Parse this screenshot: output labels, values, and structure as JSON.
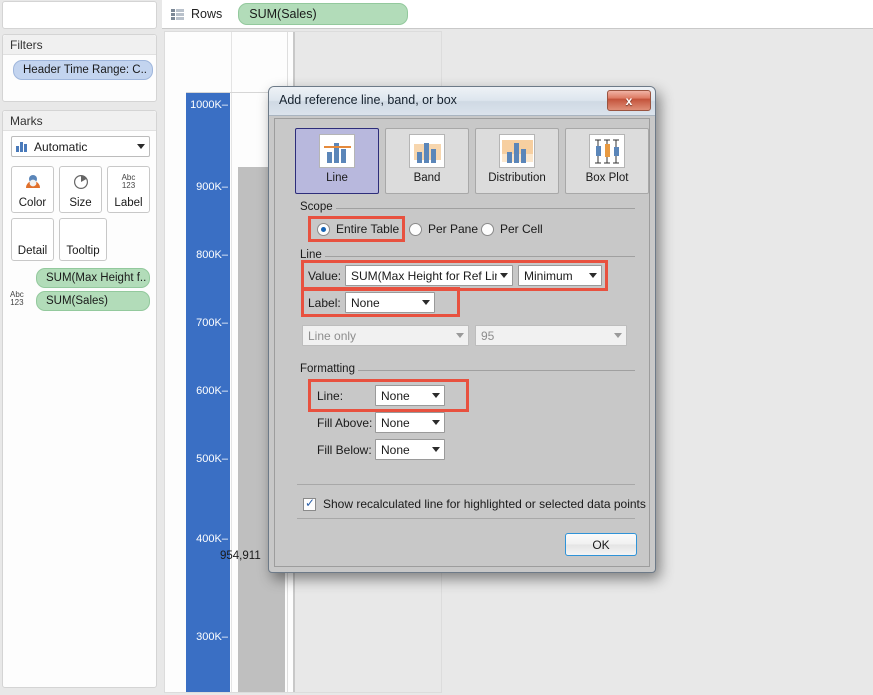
{
  "left_panel": {
    "filters": {
      "title": "Filters",
      "pills": [
        {
          "label": "Header Time Range: C..",
          "icon": "filter-pill"
        }
      ]
    },
    "marks": {
      "title": "Marks",
      "mark_type": "Automatic",
      "mark_type_icon": "bar-chart-icon",
      "buttons": [
        {
          "label": "Color",
          "icon": "color-palette-icon"
        },
        {
          "label": "Size",
          "icon": "size-pie-icon"
        },
        {
          "label": "Label",
          "icon": "abc123-icon"
        },
        {
          "label": "Detail",
          "icon": "detail-icon"
        },
        {
          "label": "Tooltip",
          "icon": "tooltip-icon"
        }
      ],
      "pills": [
        {
          "label": "SUM(Max Height f..",
          "icon": ""
        },
        {
          "label": "SUM(Sales)",
          "icon": "abc123-icon"
        }
      ]
    }
  },
  "rows_shelf": {
    "icon": "rows-grid-icon",
    "label": "Rows",
    "pill": "SUM(Sales)"
  },
  "chart_data": {
    "type": "bar",
    "title": "",
    "xlabel": "",
    "ylabel": "SUM(Sales)",
    "categories": [
      ""
    ],
    "values": [
      954911
    ],
    "data_labels": [
      "954,911"
    ],
    "ylim": [
      250000,
      1030000
    ],
    "tick_labels": [
      "1000K",
      "900K",
      "800K",
      "700K",
      "600K",
      "500K",
      "400K",
      "300K"
    ],
    "tick_values": [
      1000000,
      900000,
      800000,
      700000,
      600000,
      500000,
      400000,
      300000
    ],
    "grid": false,
    "legend_position": "none",
    "bar_color": "#bfbfbf",
    "axis_band_color": "#3a6fc4",
    "axis_label_color": "#ffffff"
  },
  "dialog": {
    "title": "Add reference line, band, or box",
    "close_label": "x",
    "close_icon": "close-icon",
    "type_tabs": [
      {
        "label": "Line",
        "icon": "reference-line-icon",
        "selected": true
      },
      {
        "label": "Band",
        "icon": "reference-band-icon",
        "selected": false
      },
      {
        "label": "Distribution",
        "icon": "reference-distribution-icon",
        "selected": false
      },
      {
        "label": "Box Plot",
        "icon": "reference-boxplot-icon",
        "selected": false
      }
    ],
    "scope": {
      "group_label": "Scope",
      "options": [
        {
          "label": "Entire Table",
          "selected": true
        },
        {
          "label": "Per Pane",
          "selected": false
        },
        {
          "label": "Per Cell",
          "selected": false
        }
      ]
    },
    "line": {
      "group_label": "Line",
      "value_label": "Value:",
      "value_field": "SUM(Max Height for Ref Line)",
      "value_aggregation": "Minimum",
      "label_label": "Label:",
      "label_value": "None",
      "line_only_value": "Line only",
      "percentile_value": "95"
    },
    "formatting": {
      "group_label": "Formatting",
      "line_label": "Line:",
      "line_value": "None",
      "fill_above_label": "Fill Above:",
      "fill_above_value": "None",
      "fill_below_label": "Fill Below:",
      "fill_below_value": "None"
    },
    "recalculate_checkbox": {
      "label": "Show recalculated line for highlighted or selected data points",
      "checked": true
    },
    "ok_label": "OK",
    "highlight_color": "#e8513f"
  }
}
